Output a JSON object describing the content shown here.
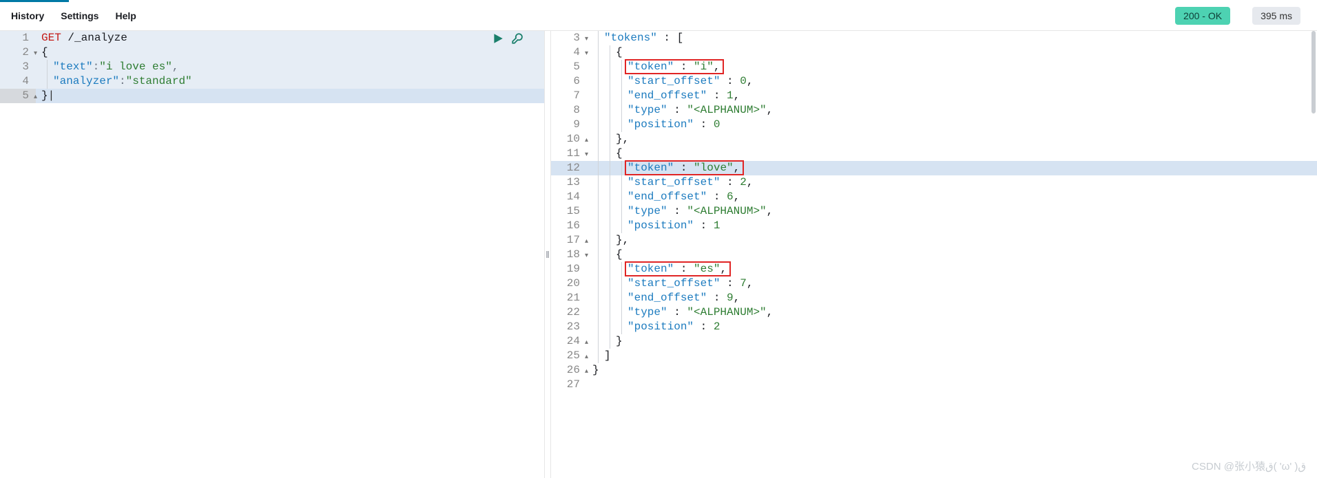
{
  "menu": {
    "history": "History",
    "settings": "Settings",
    "help": "Help"
  },
  "status": {
    "ok": "200 - OK",
    "time": "395 ms"
  },
  "request": {
    "lines": [
      {
        "n": "1",
        "fold": "",
        "method": "GET",
        "path": "/_analyze"
      },
      {
        "n": "2",
        "fold": "▾",
        "text": "{"
      },
      {
        "n": "3",
        "fold": "",
        "indent": true,
        "key": "\"text\"",
        "sep": ":",
        "val": "\"i love es\"",
        "tail": ","
      },
      {
        "n": "4",
        "fold": "",
        "indent": true,
        "key": "\"analyzer\"",
        "sep": ":",
        "val": "\"standard\"",
        "tail": ""
      },
      {
        "n": "5",
        "fold": "▴",
        "text": "}"
      }
    ]
  },
  "response": {
    "lines": [
      {
        "n": "3",
        "fold": "▾",
        "pad": 2,
        "tokens": [
          {
            "t": "key",
            "v": "\"tokens\""
          },
          {
            "t": "plain",
            "v": " : ["
          }
        ]
      },
      {
        "n": "4",
        "fold": "▾",
        "pad": 4,
        "tokens": [
          {
            "t": "plain",
            "v": "{"
          }
        ]
      },
      {
        "n": "5",
        "fold": "",
        "pad": 6,
        "box": true,
        "tokens": [
          {
            "t": "key",
            "v": "\"token\""
          },
          {
            "t": "plain",
            "v": " : "
          },
          {
            "t": "string",
            "v": "\"i\""
          },
          {
            "t": "plain",
            "v": ","
          }
        ]
      },
      {
        "n": "6",
        "fold": "",
        "pad": 6,
        "tokens": [
          {
            "t": "key",
            "v": "\"start_offset\""
          },
          {
            "t": "plain",
            "v": " : "
          },
          {
            "t": "num",
            "v": "0"
          },
          {
            "t": "plain",
            "v": ","
          }
        ]
      },
      {
        "n": "7",
        "fold": "",
        "pad": 6,
        "tokens": [
          {
            "t": "key",
            "v": "\"end_offset\""
          },
          {
            "t": "plain",
            "v": " : "
          },
          {
            "t": "num",
            "v": "1"
          },
          {
            "t": "plain",
            "v": ","
          }
        ]
      },
      {
        "n": "8",
        "fold": "",
        "pad": 6,
        "tokens": [
          {
            "t": "key",
            "v": "\"type\""
          },
          {
            "t": "plain",
            "v": " : "
          },
          {
            "t": "string",
            "v": "\"<ALPHANUM>\""
          },
          {
            "t": "plain",
            "v": ","
          }
        ]
      },
      {
        "n": "9",
        "fold": "",
        "pad": 6,
        "tokens": [
          {
            "t": "key",
            "v": "\"position\""
          },
          {
            "t": "plain",
            "v": " : "
          },
          {
            "t": "num",
            "v": "0"
          }
        ]
      },
      {
        "n": "10",
        "fold": "▴",
        "pad": 4,
        "tokens": [
          {
            "t": "plain",
            "v": "},"
          }
        ]
      },
      {
        "n": "11",
        "fold": "▾",
        "pad": 4,
        "tokens": [
          {
            "t": "plain",
            "v": "{"
          }
        ]
      },
      {
        "n": "12",
        "fold": "",
        "pad": 6,
        "sel": true,
        "box": true,
        "tokens": [
          {
            "t": "key",
            "v": "\"token\""
          },
          {
            "t": "plain",
            "v": " : "
          },
          {
            "t": "string",
            "v": "\"love\""
          },
          {
            "t": "plain",
            "v": ","
          }
        ]
      },
      {
        "n": "13",
        "fold": "",
        "pad": 6,
        "tokens": [
          {
            "t": "key",
            "v": "\"start_offset\""
          },
          {
            "t": "plain",
            "v": " : "
          },
          {
            "t": "num",
            "v": "2"
          },
          {
            "t": "plain",
            "v": ","
          }
        ]
      },
      {
        "n": "14",
        "fold": "",
        "pad": 6,
        "tokens": [
          {
            "t": "key",
            "v": "\"end_offset\""
          },
          {
            "t": "plain",
            "v": " : "
          },
          {
            "t": "num",
            "v": "6"
          },
          {
            "t": "plain",
            "v": ","
          }
        ]
      },
      {
        "n": "15",
        "fold": "",
        "pad": 6,
        "tokens": [
          {
            "t": "key",
            "v": "\"type\""
          },
          {
            "t": "plain",
            "v": " : "
          },
          {
            "t": "string",
            "v": "\"<ALPHANUM>\""
          },
          {
            "t": "plain",
            "v": ","
          }
        ]
      },
      {
        "n": "16",
        "fold": "",
        "pad": 6,
        "tokens": [
          {
            "t": "key",
            "v": "\"position\""
          },
          {
            "t": "plain",
            "v": " : "
          },
          {
            "t": "num",
            "v": "1"
          }
        ]
      },
      {
        "n": "17",
        "fold": "▴",
        "pad": 4,
        "tokens": [
          {
            "t": "plain",
            "v": "},"
          }
        ]
      },
      {
        "n": "18",
        "fold": "▾",
        "pad": 4,
        "tokens": [
          {
            "t": "plain",
            "v": "{"
          }
        ]
      },
      {
        "n": "19",
        "fold": "",
        "pad": 6,
        "box": true,
        "tokens": [
          {
            "t": "key",
            "v": "\"token\""
          },
          {
            "t": "plain",
            "v": " : "
          },
          {
            "t": "string",
            "v": "\"es\""
          },
          {
            "t": "plain",
            "v": ","
          }
        ]
      },
      {
        "n": "20",
        "fold": "",
        "pad": 6,
        "tokens": [
          {
            "t": "key",
            "v": "\"start_offset\""
          },
          {
            "t": "plain",
            "v": " : "
          },
          {
            "t": "num",
            "v": "7"
          },
          {
            "t": "plain",
            "v": ","
          }
        ]
      },
      {
        "n": "21",
        "fold": "",
        "pad": 6,
        "tokens": [
          {
            "t": "key",
            "v": "\"end_offset\""
          },
          {
            "t": "plain",
            "v": " : "
          },
          {
            "t": "num",
            "v": "9"
          },
          {
            "t": "plain",
            "v": ","
          }
        ]
      },
      {
        "n": "22",
        "fold": "",
        "pad": 6,
        "tokens": [
          {
            "t": "key",
            "v": "\"type\""
          },
          {
            "t": "plain",
            "v": " : "
          },
          {
            "t": "string",
            "v": "\"<ALPHANUM>\""
          },
          {
            "t": "plain",
            "v": ","
          }
        ]
      },
      {
        "n": "23",
        "fold": "",
        "pad": 6,
        "tokens": [
          {
            "t": "key",
            "v": "\"position\""
          },
          {
            "t": "plain",
            "v": " : "
          },
          {
            "t": "num",
            "v": "2"
          }
        ]
      },
      {
        "n": "24",
        "fold": "▴",
        "pad": 4,
        "tokens": [
          {
            "t": "plain",
            "v": "}"
          }
        ]
      },
      {
        "n": "25",
        "fold": "▴",
        "pad": 2,
        "tokens": [
          {
            "t": "plain",
            "v": "]"
          }
        ]
      },
      {
        "n": "26",
        "fold": "▴",
        "pad": 0,
        "tokens": [
          {
            "t": "plain",
            "v": "}"
          }
        ]
      },
      {
        "n": "27",
        "fold": "",
        "pad": 0,
        "tokens": []
      }
    ]
  },
  "icons": {
    "play": "play-icon",
    "wrench": "wrench-icon",
    "splitter": "‖"
  },
  "watermark": "CSDN @张小猿ق( 'ω' )ق"
}
